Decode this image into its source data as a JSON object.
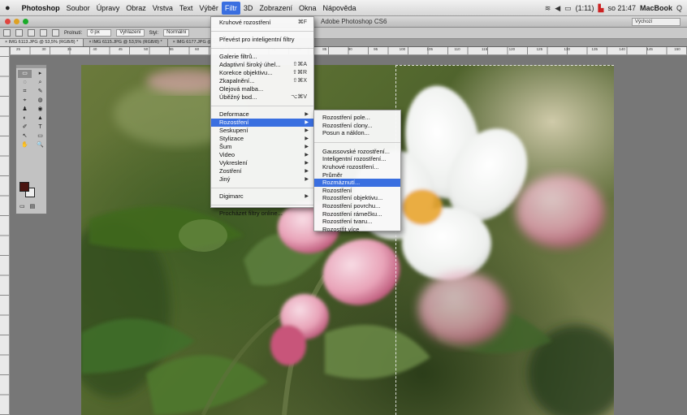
{
  "menubar": {
    "apple": "",
    "items": [
      "Photoshop",
      "Soubor",
      "Úpravy",
      "Obraz",
      "Vrstva",
      "Text",
      "Výběr",
      "Filtr",
      "3D",
      "Zobrazení",
      "Okna",
      "Nápověda"
    ],
    "active_index": 7,
    "status": {
      "time": "so 21:47",
      "machine": "MacBook",
      "battery": "(1:11)",
      "search_icon": "Q"
    }
  },
  "app": {
    "title": "Adobe Photoshop CS6",
    "workspace": "Výchozí"
  },
  "options_bar": {
    "prolnuti_label": "Prolnutí:",
    "prolnuti_value": "0 px",
    "vyhlazeni": "Vyhlazení",
    "styl_label": "Styl:",
    "styl_value": "Normální"
  },
  "tabs": [
    "IMG 6113.JPG @ 53,5% (RGB/8) *",
    "IMG 6115.JPG @ 53,5% (RGB/8) *",
    "IMG 6177.JPG @ 5…"
  ],
  "ruler_numbers": [
    "25",
    "30",
    "35",
    "40",
    "45",
    "50",
    "55",
    "60",
    "65",
    "70",
    "75",
    "80",
    "85",
    "90",
    "95",
    "100",
    "105",
    "110",
    "115",
    "120",
    "125",
    "130",
    "135",
    "140",
    "145",
    "150"
  ],
  "filter_menu": {
    "items": [
      {
        "label": "Kruhové rozostření",
        "shortcut": "⌘F"
      },
      {
        "sep": true
      },
      {
        "label": "Převést pro inteligentní filtry"
      },
      {
        "sep": true
      },
      {
        "label": "Galerie filtrů..."
      },
      {
        "label": "Adaptivní široký úhel...",
        "shortcut": "⇧⌘A"
      },
      {
        "label": "Korekce objektivu...",
        "shortcut": "⇧⌘R"
      },
      {
        "label": "Zkapalnění...",
        "shortcut": "⇧⌘X"
      },
      {
        "label": "Olejová malba..."
      },
      {
        "label": "Úběžný bod...",
        "shortcut": "⌥⌘V"
      },
      {
        "sep": true
      },
      {
        "label": "Deformace",
        "submenu": true
      },
      {
        "label": "Rozostření",
        "submenu": true,
        "highlight": true
      },
      {
        "label": "Seskupení",
        "submenu": true
      },
      {
        "label": "Stylizace",
        "submenu": true
      },
      {
        "label": "Šum",
        "submenu": true
      },
      {
        "label": "Video",
        "submenu": true
      },
      {
        "label": "Vykreslení",
        "submenu": true
      },
      {
        "label": "Zostření",
        "submenu": true
      },
      {
        "label": "Jiný",
        "submenu": true
      },
      {
        "sep": true
      },
      {
        "label": "Digimarc",
        "submenu": true
      },
      {
        "sep": true
      },
      {
        "label": "Procházet filtry online..."
      }
    ]
  },
  "blur_submenu": {
    "items": [
      {
        "label": "Rozostření pole..."
      },
      {
        "label": "Rozostření clony..."
      },
      {
        "label": "Posun a náklon..."
      },
      {
        "sep": true
      },
      {
        "label": "Gaussovské rozostření..."
      },
      {
        "label": "Inteligentní rozostření..."
      },
      {
        "label": "Kruhové rozostření..."
      },
      {
        "label": "Průměr"
      },
      {
        "label": "Rozmáznutí...",
        "highlight": true
      },
      {
        "label": "Rozostření"
      },
      {
        "label": "Rozostření objektivu..."
      },
      {
        "label": "Rozostření povrchu..."
      },
      {
        "label": "Rozostření rámečku..."
      },
      {
        "label": "Rozostření tvaru..."
      },
      {
        "label": "Rozostřit více"
      }
    ]
  },
  "tools": [
    "▭",
    "▸",
    "◌",
    "⌕",
    "⌗",
    "✎",
    "⌖",
    "◍",
    "♟",
    "◉",
    "◐",
    "▲",
    "✐",
    "T",
    "↖",
    "▭",
    "✋",
    "🔍"
  ],
  "colors": {
    "highlight": "#3a6fe0",
    "foreground_swatch": "#4a1410",
    "background_swatch": "#eeeeee"
  }
}
